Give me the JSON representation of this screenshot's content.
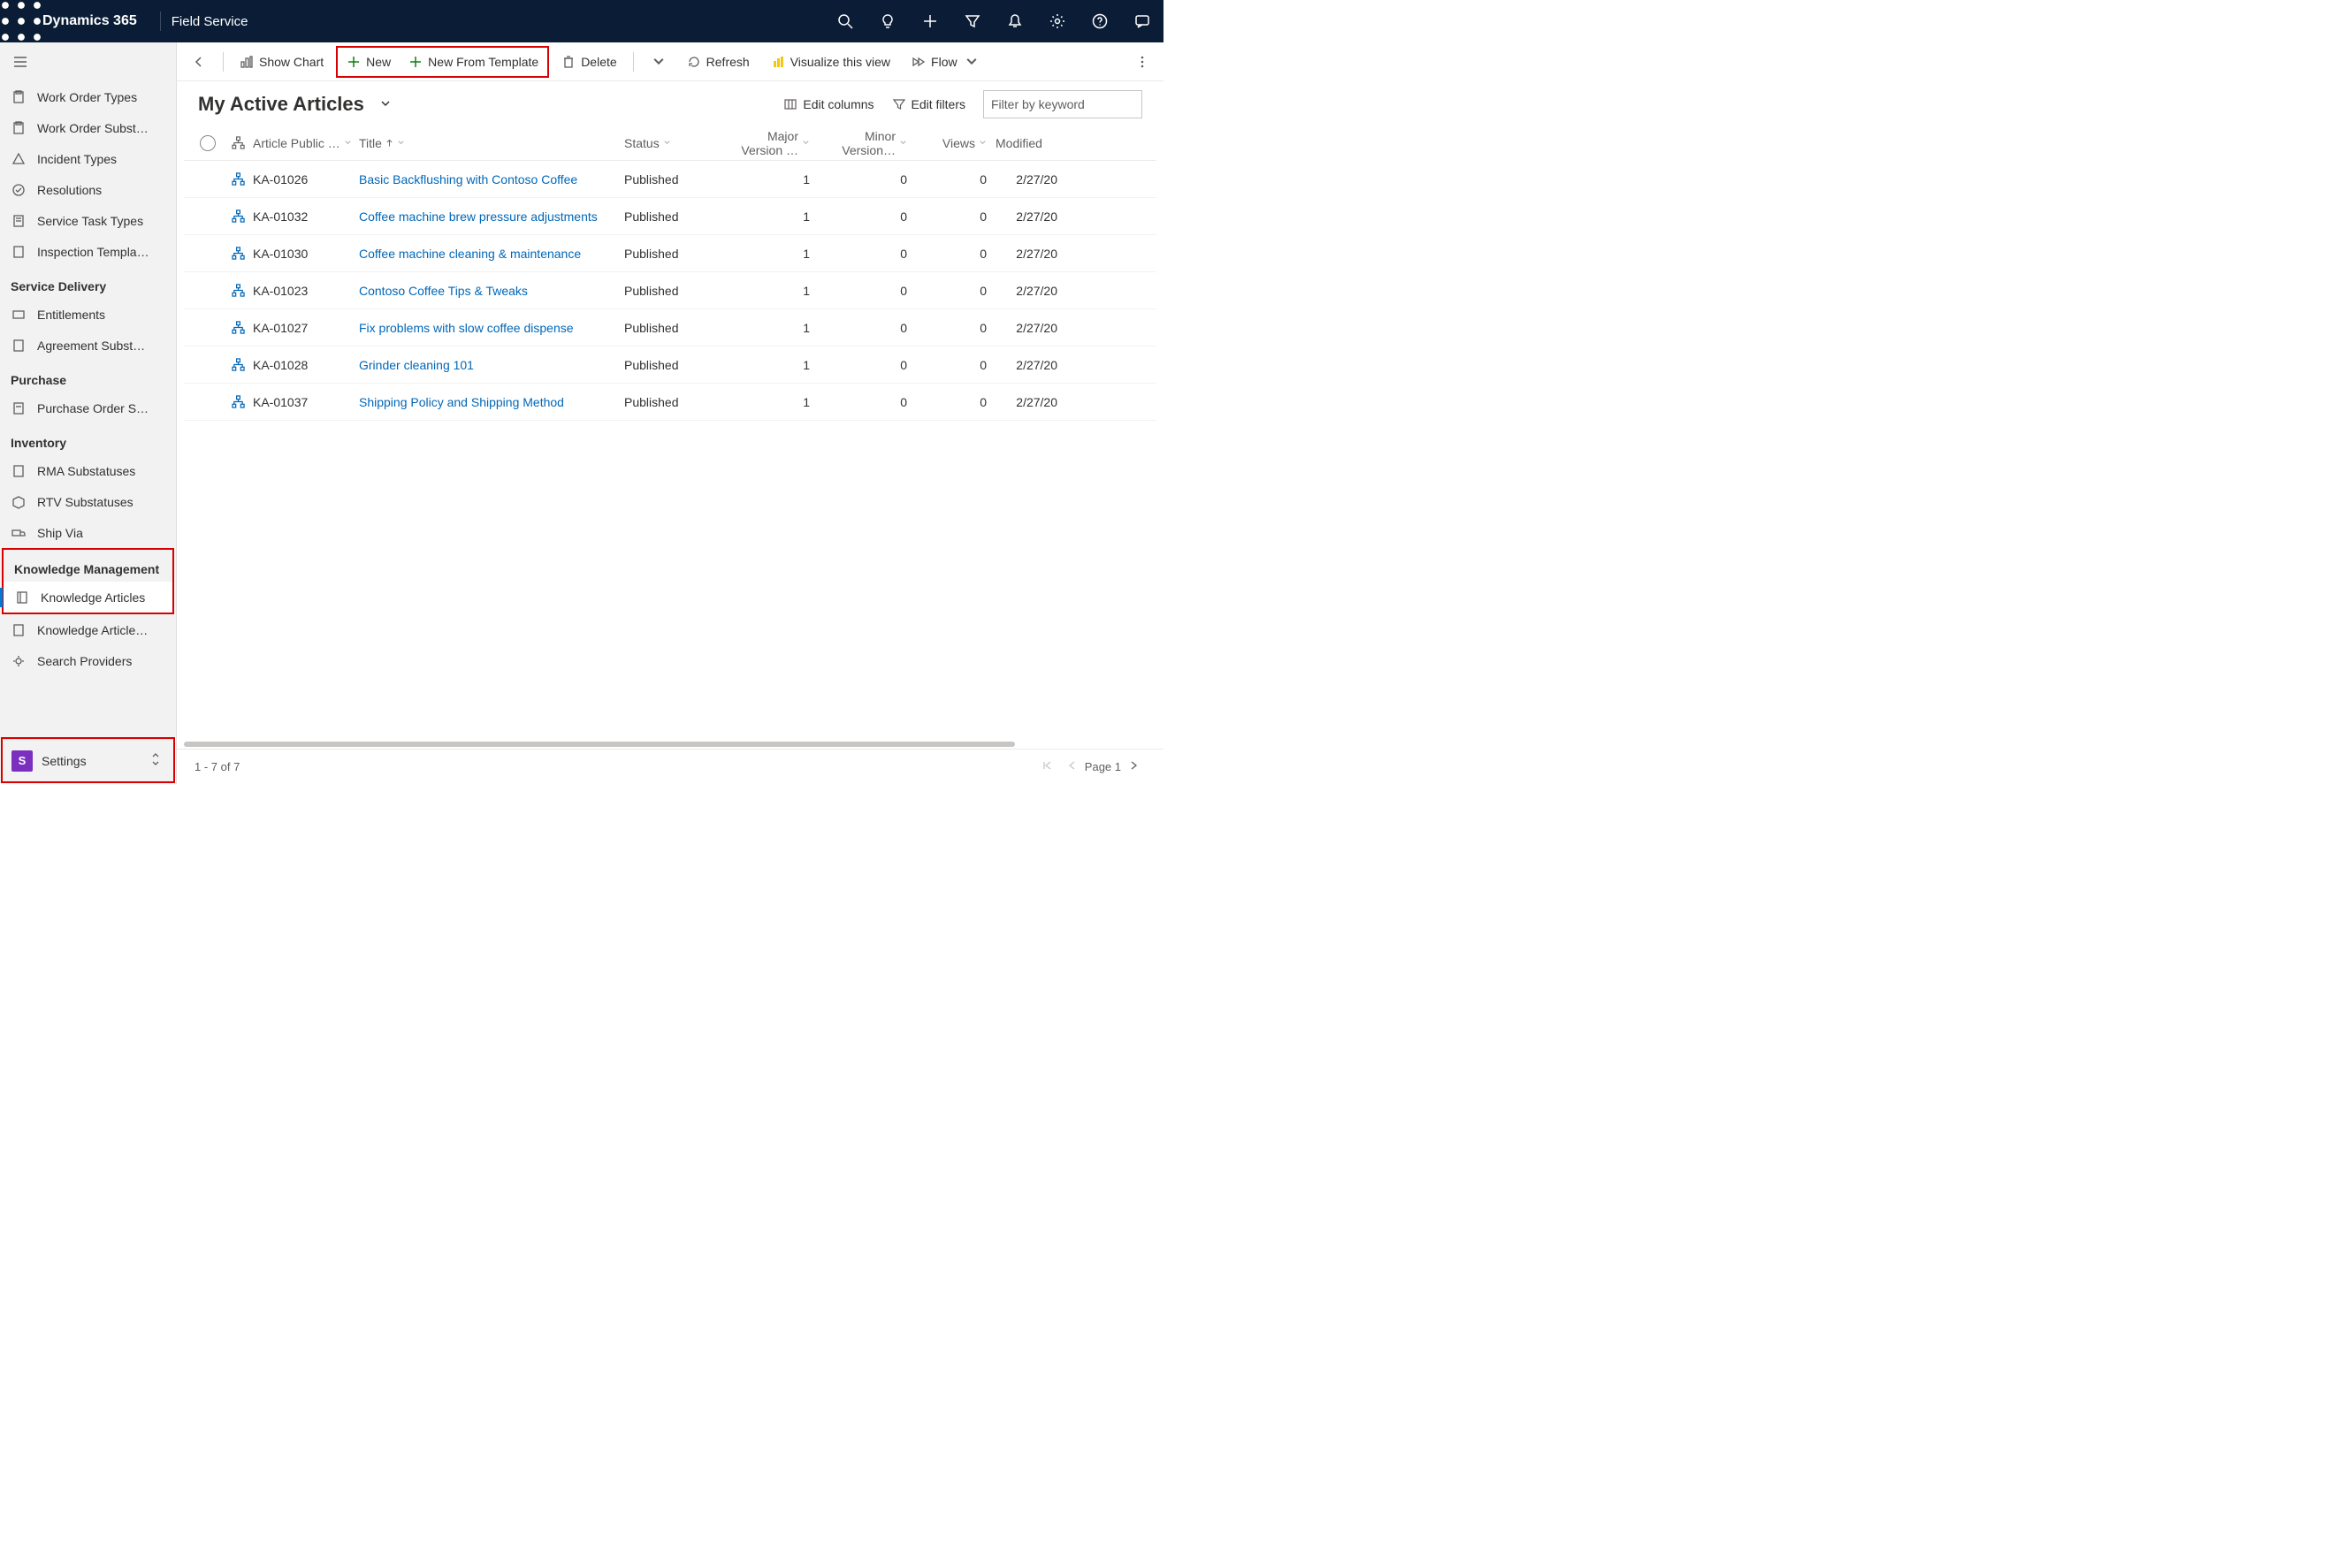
{
  "header": {
    "brand": "Dynamics 365",
    "app": "Field Service"
  },
  "sidebar": {
    "items_top": [
      {
        "label": "Work Order Types"
      },
      {
        "label": "Work Order Subst…"
      },
      {
        "label": "Incident Types"
      },
      {
        "label": "Resolutions"
      },
      {
        "label": "Service Task Types"
      },
      {
        "label": "Inspection Templa…"
      }
    ],
    "group_service": "Service Delivery",
    "items_service": [
      {
        "label": "Entitlements"
      },
      {
        "label": "Agreement Subst…"
      }
    ],
    "group_purchase": "Purchase",
    "items_purchase": [
      {
        "label": "Purchase Order S…"
      }
    ],
    "group_inventory": "Inventory",
    "items_inventory": [
      {
        "label": "RMA Substatuses"
      },
      {
        "label": "RTV Substatuses"
      },
      {
        "label": "Ship Via"
      }
    ],
    "group_km": "Knowledge Management",
    "items_km": [
      {
        "label": "Knowledge Articles",
        "selected": true
      },
      {
        "label": "Knowledge Article…"
      },
      {
        "label": "Search Providers"
      }
    ],
    "switcher": {
      "badge": "S",
      "label": "Settings"
    }
  },
  "commands": {
    "show_chart": "Show Chart",
    "new": "New",
    "new_template": "New From Template",
    "delete": "Delete",
    "refresh": "Refresh",
    "visualize": "Visualize this view",
    "flow": "Flow"
  },
  "view": {
    "title": "My Active Articles",
    "edit_columns": "Edit columns",
    "edit_filters": "Edit filters",
    "filter_placeholder": "Filter by keyword"
  },
  "columns": {
    "pub": "Article Public …",
    "title": "Title",
    "status": "Status",
    "major": "Major Version …",
    "minor": "Minor Version…",
    "views": "Views",
    "modified": "Modified"
  },
  "rows": [
    {
      "pub": "KA-01026",
      "title": "Basic Backflushing with Contoso Coffee",
      "status": "Published",
      "major": "1",
      "minor": "0",
      "views": "0",
      "mod": "2/27/20"
    },
    {
      "pub": "KA-01032",
      "title": "Coffee machine brew pressure adjustments",
      "status": "Published",
      "major": "1",
      "minor": "0",
      "views": "0",
      "mod": "2/27/20"
    },
    {
      "pub": "KA-01030",
      "title": "Coffee machine cleaning & maintenance",
      "status": "Published",
      "major": "1",
      "minor": "0",
      "views": "0",
      "mod": "2/27/20"
    },
    {
      "pub": "KA-01023",
      "title": "Contoso Coffee Tips & Tweaks",
      "status": "Published",
      "major": "1",
      "minor": "0",
      "views": "0",
      "mod": "2/27/20"
    },
    {
      "pub": "KA-01027",
      "title": "Fix problems with slow coffee dispense",
      "status": "Published",
      "major": "1",
      "minor": "0",
      "views": "0",
      "mod": "2/27/20"
    },
    {
      "pub": "KA-01028",
      "title": "Grinder cleaning 101",
      "status": "Published",
      "major": "1",
      "minor": "0",
      "views": "0",
      "mod": "2/27/20"
    },
    {
      "pub": "KA-01037",
      "title": "Shipping Policy and Shipping Method",
      "status": "Published",
      "major": "1",
      "minor": "0",
      "views": "0",
      "mod": "2/27/20"
    }
  ],
  "footer": {
    "count": "1 - 7 of 7",
    "page": "Page 1"
  }
}
